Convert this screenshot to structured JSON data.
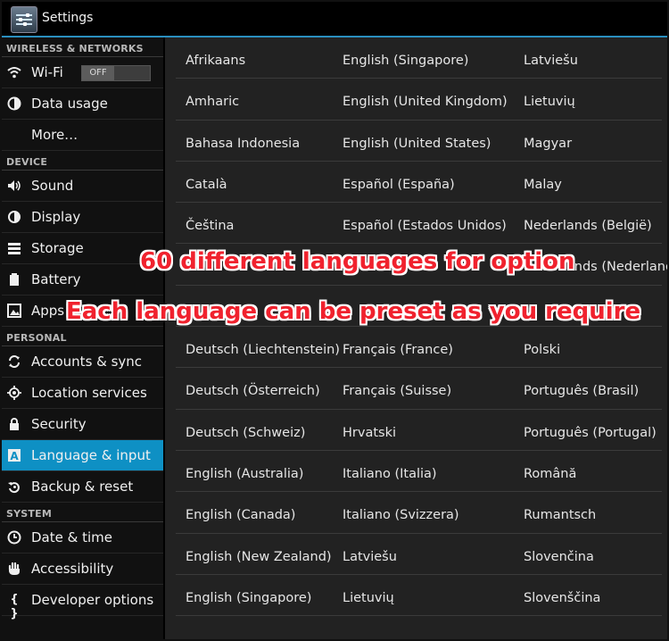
{
  "title_bar": {
    "title": "Settings",
    "icon": "settings-app-icon"
  },
  "sidebar": {
    "sections": [
      {
        "label": "WIRELESS & NETWORKS"
      },
      {
        "label": "DEVICE"
      },
      {
        "label": "PERSONAL"
      },
      {
        "label": "SYSTEM"
      }
    ],
    "items": [
      {
        "label": "Wi-Fi",
        "icon": "wifi-icon",
        "toggle": "OFF"
      },
      {
        "label": "Data usage",
        "icon": "data-usage-icon"
      },
      {
        "label": "More…",
        "icon": ""
      },
      {
        "label": "Sound",
        "icon": "volume-icon"
      },
      {
        "label": "Display",
        "icon": "brightness-icon"
      },
      {
        "label": "Storage",
        "icon": "storage-icon"
      },
      {
        "label": "Battery",
        "icon": "battery-icon"
      },
      {
        "label": "Apps",
        "icon": "apps-icon"
      },
      {
        "label": "Accounts & sync",
        "icon": "sync-icon"
      },
      {
        "label": "Location services",
        "icon": "location-icon"
      },
      {
        "label": "Security",
        "icon": "lock-icon"
      },
      {
        "label": "Language & input",
        "icon": "keyboard-a-icon",
        "active": true
      },
      {
        "label": "Backup & reset",
        "icon": "backup-icon"
      },
      {
        "label": "Date & time",
        "icon": "clock-icon"
      },
      {
        "label": "Accessibility",
        "icon": "hand-icon"
      },
      {
        "label": "Developer options",
        "icon": "braces-icon"
      }
    ]
  },
  "languages": {
    "rows": [
      [
        "Afrikaans",
        "English (Singapore)",
        "Latviešu"
      ],
      [
        "Amharic",
        "English (United Kingdom)",
        "Lietuvių"
      ],
      [
        "Bahasa Indonesia",
        "English (United States)",
        "Magyar"
      ],
      [
        "Català",
        "Español (España)",
        "Malay"
      ],
      [
        "Čeština",
        "Español (Estados Unidos)",
        "Nederlands (België)"
      ],
      [
        "",
        "",
        "Nederlands (Nederland)"
      ],
      [
        "",
        "",
        ""
      ],
      [
        "Deutsch (Liechtenstein)",
        "Français (France)",
        "Polski"
      ],
      [
        "Deutsch (Österreich)",
        "Français (Suisse)",
        "Português (Brasil)"
      ],
      [
        "Deutsch (Schweiz)",
        "Hrvatski",
        "Português (Portugal)"
      ],
      [
        "English (Australia)",
        "Italiano (Italia)",
        "Română"
      ],
      [
        "English (Canada)",
        "Italiano (Svizzera)",
        "Rumantsch"
      ],
      [
        "English (New Zealand)",
        "Latviešu",
        "Slovenčina"
      ],
      [
        "English (Singapore)",
        "Lietuvių",
        "Slovenščina"
      ]
    ]
  },
  "overlay": {
    "line1": "60 different languages for option",
    "line2": "Each language can be preset as you require"
  },
  "colors": {
    "accent": "#0e90c4",
    "overlay_text": "#f0222e",
    "title_underline": "#2a8fbf"
  }
}
